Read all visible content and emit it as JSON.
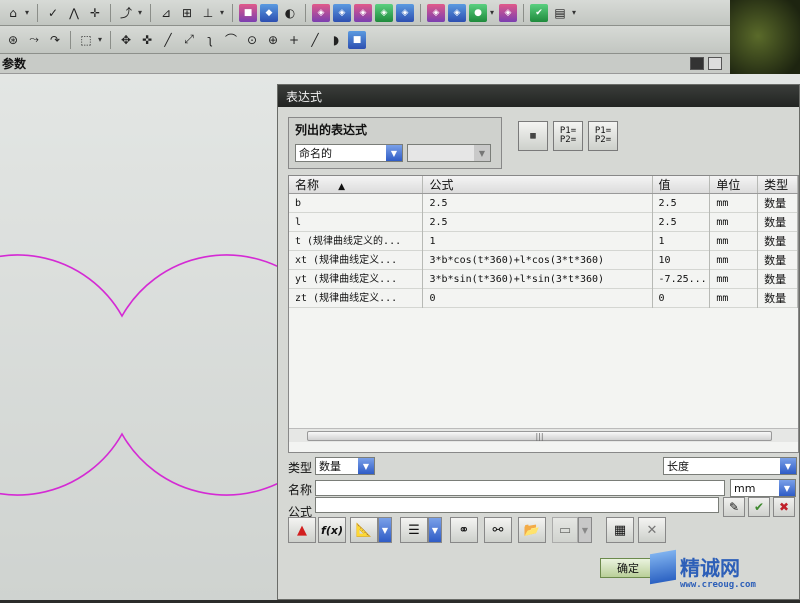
{
  "param_bar": {
    "label": "参数"
  },
  "dialog": {
    "title": "表达式",
    "list_group": {
      "title": "列出的表达式",
      "filter_value": "命名的",
      "secondary_value": ""
    },
    "table": {
      "headers": {
        "name": "名称",
        "formula": "公式",
        "value": "值",
        "unit": "单位",
        "type": "类型"
      },
      "sort_indicator": "▲",
      "rows": [
        {
          "name": "b",
          "formula": "2.5",
          "value": "2.5",
          "unit": "mm",
          "type": "数量"
        },
        {
          "name": "l",
          "formula": "2.5",
          "value": "2.5",
          "unit": "mm",
          "type": "数量"
        },
        {
          "name": "t  (规律曲线定义的...",
          "formula": "1",
          "value": "1",
          "unit": "mm",
          "type": "数量"
        },
        {
          "name": "xt  (规律曲线定义...",
          "formula": "3*b*cos(t*360)+l*cos(3*t*360)",
          "value": "10",
          "unit": "mm",
          "type": "数量"
        },
        {
          "name": "yt  (规律曲线定义...",
          "formula": "3*b*sin(t*360)+l*sin(3*t*360)",
          "value": "-7.25...",
          "unit": "mm",
          "type": "数量"
        },
        {
          "name": "zt  (规律曲线定义...",
          "formula": "0",
          "value": "0",
          "unit": "mm",
          "type": "数量"
        }
      ]
    },
    "type_label": "类型",
    "type_value": "数量",
    "dimension_value": "长度",
    "name_label": "名称",
    "name_value": "",
    "unit_value": "mm",
    "formula_label": "公式",
    "formula_value": "",
    "ok_label": "确定",
    "fx_label": "f(x)"
  },
  "watermark": {
    "brand": "精诚网",
    "url": "www.creoug.com"
  },
  "colors": {
    "curve": "#d42ad4",
    "dialog_title_bg": "#2d302d",
    "accent_arrow": "#2f5cc6"
  }
}
